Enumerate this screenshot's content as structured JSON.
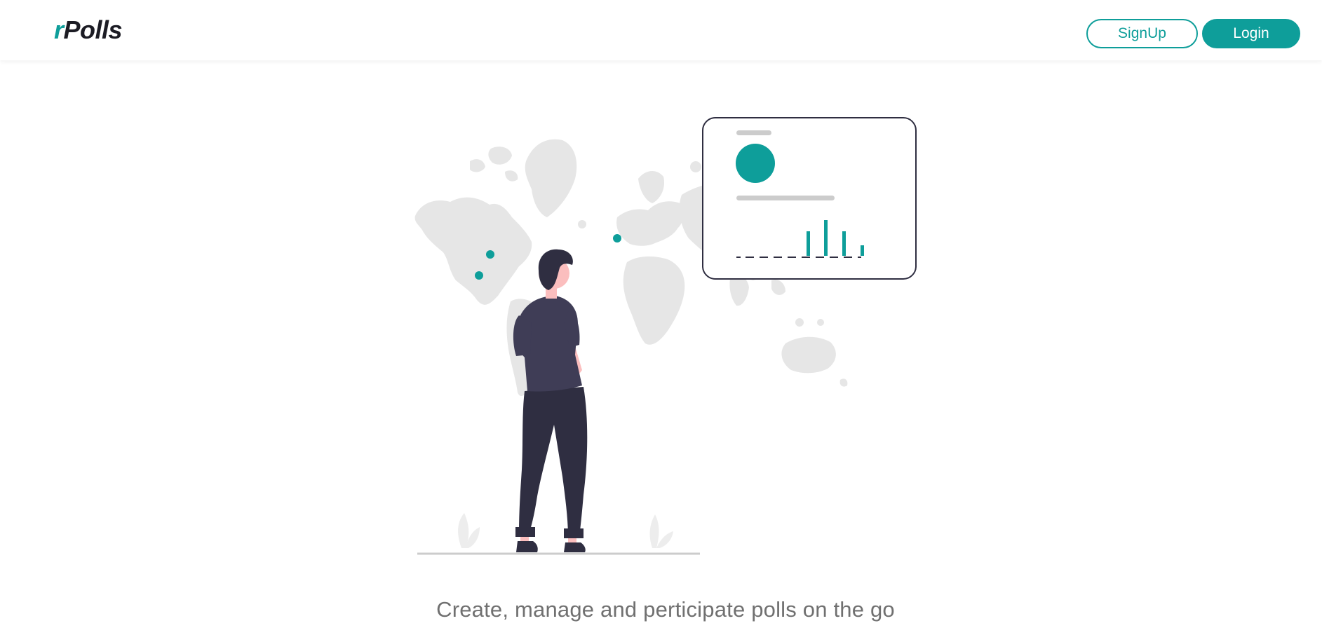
{
  "header": {
    "logo_prefix": "r",
    "logo_rest": "Polls",
    "signup_label": "SignUp",
    "login_label": "Login"
  },
  "hero": {
    "tagline": "Create, manage and perticipate polls on the go"
  },
  "colors": {
    "accent": "#0e9e9a",
    "text_dark": "#1c1c24",
    "text_muted": "#707070",
    "map_gray": "#e6e6e6"
  },
  "icons": {
    "illustration": "person-looking-at-world-map-with-poll-card"
  }
}
